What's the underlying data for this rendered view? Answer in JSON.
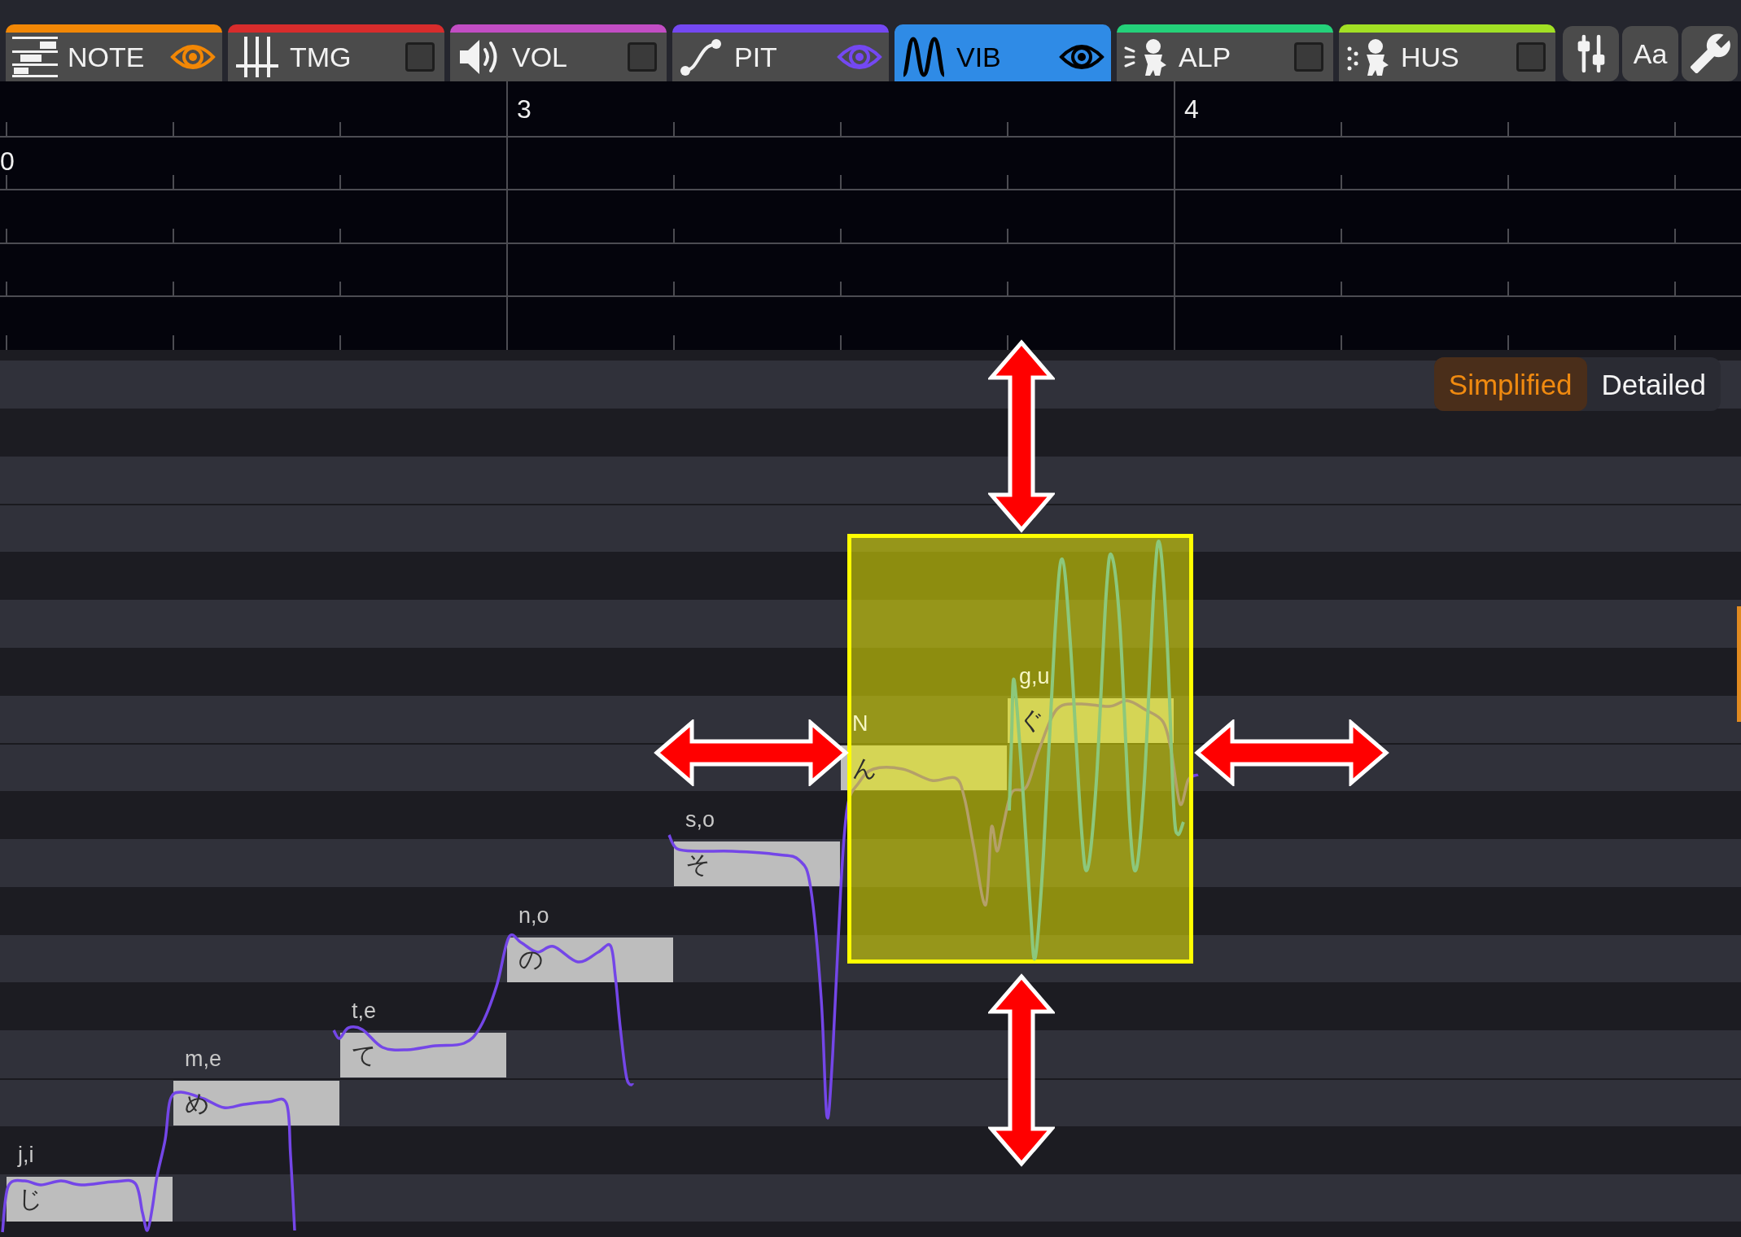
{
  "toolbar": {
    "tabs": [
      {
        "label": "NOTE",
        "color": "#f28705",
        "shown": true,
        "selected": false
      },
      {
        "label": "TMG",
        "color": "#d82c2c",
        "shown": false,
        "selected": false
      },
      {
        "label": "VOL",
        "color": "#c24dc4",
        "shown": false,
        "selected": false
      },
      {
        "label": "PIT",
        "color": "#7448f2",
        "shown": true,
        "selected": false
      },
      {
        "label": "VIB",
        "color": "#2f8be6",
        "shown": true,
        "selected": true
      },
      {
        "label": "ALP",
        "color": "#24d17a",
        "shown": false,
        "selected": false
      },
      {
        "label": "HUS",
        "color": "#a2e024",
        "shown": false,
        "selected": false
      }
    ],
    "font_button": {
      "label": "Aa"
    }
  },
  "ruler": {
    "bar_numbers": [
      "3",
      "4"
    ],
    "lane_2_label": "0"
  },
  "view_toggle": [
    {
      "label": "Simplified",
      "selected": true
    },
    {
      "label": "Detailed",
      "selected": false
    }
  ],
  "notes": [
    {
      "phoneme": "j,i",
      "lyric": "じ"
    },
    {
      "phoneme": "m,e",
      "lyric": "め"
    },
    {
      "phoneme": "t,e",
      "lyric": "て"
    },
    {
      "phoneme": "n,o",
      "lyric": "の"
    },
    {
      "phoneme": "s,o",
      "lyric": "そ"
    },
    {
      "phoneme": "N",
      "lyric": "ん"
    },
    {
      "phoneme": "g,u",
      "lyric": "ぐ"
    }
  ]
}
